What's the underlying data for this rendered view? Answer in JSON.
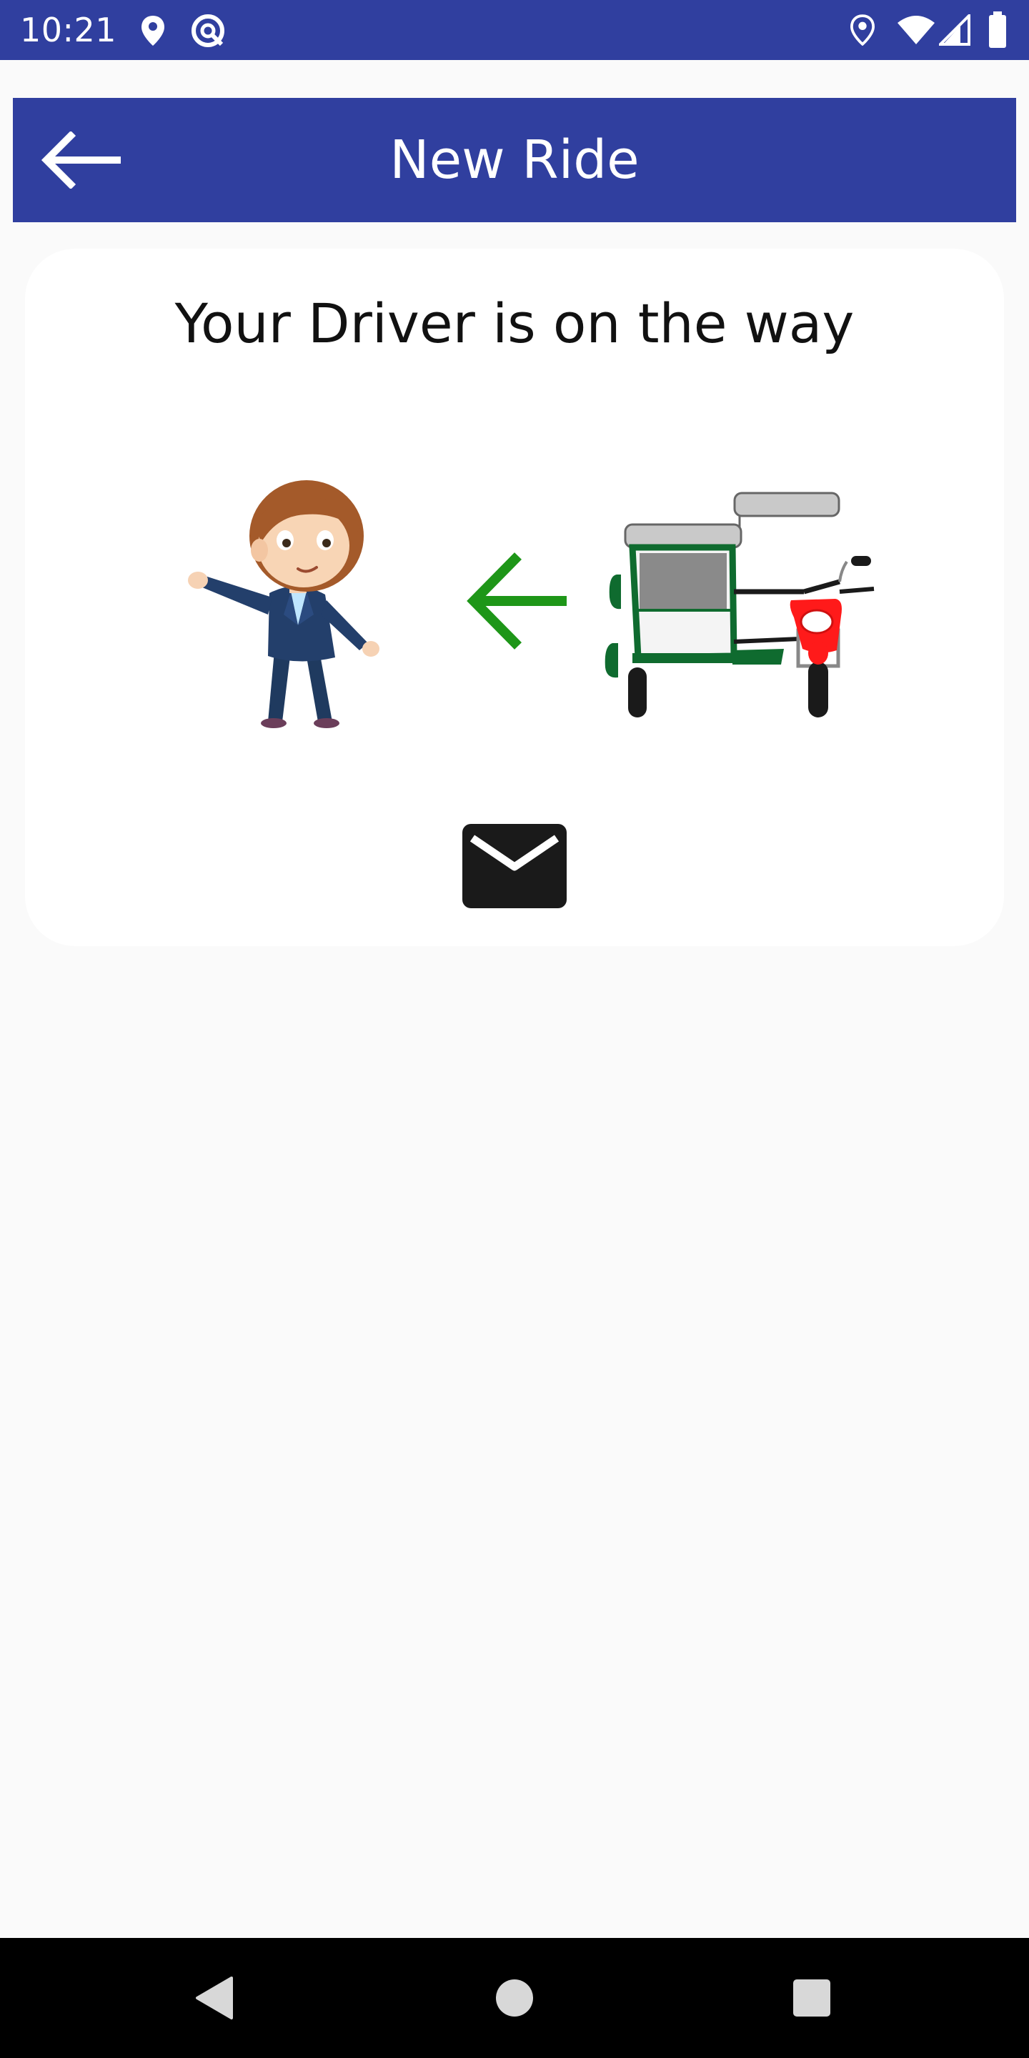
{
  "status_bar": {
    "time": "10:21",
    "left_icons": [
      "location-pin-icon",
      "data-saver-icon"
    ],
    "right_icons": [
      "location-pin-icon",
      "wifi-icon",
      "cell-signal-icon",
      "battery-icon"
    ]
  },
  "app_bar": {
    "title": "New Ride",
    "back_icon": "arrow-back-icon",
    "color": "#303f9f"
  },
  "ride_card": {
    "heading": "Your Driver is on the way",
    "passenger_icon": "passenger-icon",
    "direction_icon": "arrow-left-icon",
    "direction_color": "#1e9618",
    "vehicle_icon": "tricycle-icon",
    "mail_icon": "mail-icon"
  },
  "nav_bar": {
    "icons": [
      "back-triangle-icon",
      "home-circle-icon",
      "recents-square-icon"
    ]
  }
}
